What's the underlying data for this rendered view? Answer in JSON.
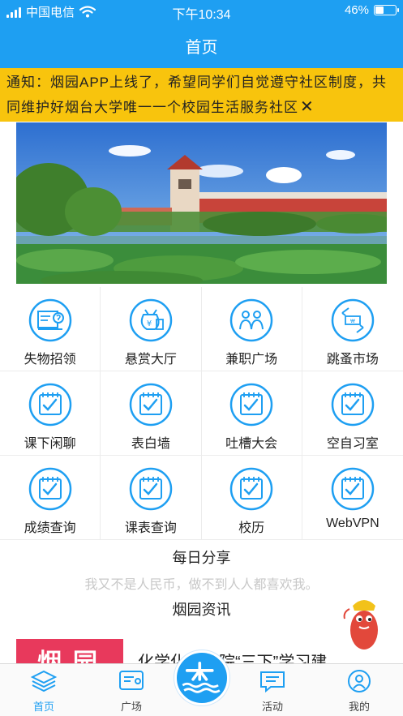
{
  "status_bar": {
    "carrier": "中国电信",
    "time": "下午10:34",
    "battery": "46%",
    "battery_level": 0.46
  },
  "header": {
    "title": "首页"
  },
  "notice": {
    "text": "通知：烟园APP上线了，希望同学们自觉遵守社区制度，共同维护好烟台大学唯一一个校园生活服务社区",
    "close_icon": "close-icon"
  },
  "grid": [
    {
      "label": "失物招领",
      "icon": "lost-found-icon"
    },
    {
      "label": "悬赏大厅",
      "icon": "reward-bag-icon"
    },
    {
      "label": "兼职广场",
      "icon": "part-time-icon"
    },
    {
      "label": "跳蚤市场",
      "icon": "flea-market-icon"
    },
    {
      "label": "课下闲聊",
      "icon": "notepad-check-icon"
    },
    {
      "label": "表白墙",
      "icon": "notepad-check-icon"
    },
    {
      "label": "吐槽大会",
      "icon": "notepad-check-icon"
    },
    {
      "label": "空自习室",
      "icon": "notepad-check-icon"
    },
    {
      "label": "成绩查询",
      "icon": "notepad-check-icon"
    },
    {
      "label": "课表查询",
      "icon": "notepad-check-icon"
    },
    {
      "label": "校历",
      "icon": "notepad-check-icon"
    },
    {
      "label": "WebVPN",
      "icon": "notepad-check-icon"
    }
  ],
  "daily_share": {
    "title": "每日分享",
    "quote": "我又不是人民币，做不到人人都喜欢我。"
  },
  "news": {
    "title": "烟园资讯",
    "thumb_text": "烟园",
    "headline": "化学化工学院“三下”学习建"
  },
  "tabbar": [
    {
      "label": "首页",
      "icon": "layers-icon",
      "active": true
    },
    {
      "label": "广场",
      "icon": "square-chat-icon",
      "active": false
    },
    {
      "label": "活动",
      "icon": "message-icon",
      "active": false
    },
    {
      "label": "我的",
      "icon": "user-icon",
      "active": false
    }
  ],
  "colors": {
    "primary": "#1e9ff2",
    "notice_bg": "#f8c40d",
    "news_thumb": "#e8395c"
  }
}
